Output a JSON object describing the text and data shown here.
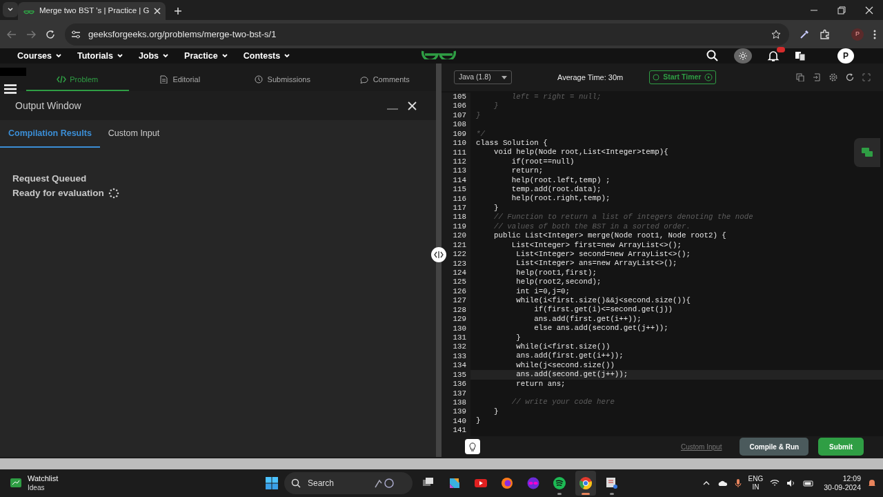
{
  "browser": {
    "tab_title": "Merge two BST 's | Practice | G",
    "url": "geeksforgeeks.org/problems/merge-two-bst-s/1",
    "profile": "P"
  },
  "site_nav": {
    "menus": [
      {
        "label": "Courses"
      },
      {
        "label": "Tutorials"
      },
      {
        "label": "Jobs"
      },
      {
        "label": "Practice"
      },
      {
        "label": "Contests"
      }
    ],
    "avatar": "P"
  },
  "problem_tabs": [
    {
      "label": "Problem",
      "selected": true
    },
    {
      "label": "Editorial",
      "selected": false
    },
    {
      "label": "Submissions",
      "selected": false
    },
    {
      "label": "Comments",
      "selected": false
    }
  ],
  "output_window": {
    "title": "Output Window",
    "tabs": [
      {
        "label": "Compilation Results",
        "selected": true
      },
      {
        "label": "Custom Input",
        "selected": false
      }
    ],
    "messages": [
      {
        "text": "Request Queued",
        "loading": false
      },
      {
        "text": "Ready for evaluation",
        "loading": true
      }
    ]
  },
  "editor": {
    "language": "Java (1.8)",
    "average_time": "Average Time: 30m",
    "timer_button": "Start Timer",
    "lines": [
      {
        "num": "105",
        "kind": "comment",
        "current": false,
        "text": "        left = right = null;"
      },
      {
        "num": "106",
        "kind": "comment",
        "current": false,
        "text": "    }"
      },
      {
        "num": "107",
        "kind": "comment",
        "current": false,
        "text": "}"
      },
      {
        "num": "108",
        "current": false
      },
      {
        "num": "109",
        "kind": "comment",
        "current": false,
        "text": "*/"
      },
      {
        "num": "110",
        "kind": "code",
        "current": false,
        "text": "class Solution {"
      },
      {
        "num": "111",
        "kind": "code",
        "current": false,
        "text": "    void help(Node root,List<Integer>temp){"
      },
      {
        "num": "112",
        "kind": "code",
        "current": false,
        "text": "        if(root==null)"
      },
      {
        "num": "113",
        "kind": "code",
        "current": false,
        "text": "        return;"
      },
      {
        "num": "114",
        "kind": "code",
        "current": false,
        "text": "        help(root.left,temp) ;"
      },
      {
        "num": "115",
        "kind": "code",
        "current": false,
        "text": "        temp.add(root.data);"
      },
      {
        "num": "116",
        "kind": "code",
        "current": false,
        "text": "        help(root.right,temp);"
      },
      {
        "num": "117",
        "kind": "code",
        "current": false,
        "text": "    }"
      },
      {
        "num": "118",
        "kind": "comment",
        "current": false,
        "text": "    // Function to return a list of integers denoting the node"
      },
      {
        "num": "119",
        "kind": "comment",
        "current": false,
        "text": "    // values of both the BST in a sorted order."
      },
      {
        "num": "120",
        "kind": "code",
        "current": false,
        "text": "    public List<Integer> merge(Node root1, Node root2) {"
      },
      {
        "num": "121",
        "kind": "code",
        "current": false,
        "text": "        List<Integer> first=new ArrayList<>();"
      },
      {
        "num": "122",
        "kind": "code",
        "current": false,
        "text": "         List<Integer> second=new ArrayList<>();"
      },
      {
        "num": "123",
        "kind": "code",
        "current": false,
        "text": "         List<Integer> ans=new ArrayList<>();"
      },
      {
        "num": "124",
        "kind": "code",
        "current": false,
        "text": "         help(root1,first);"
      },
      {
        "num": "125",
        "kind": "code",
        "current": false,
        "text": "         help(root2,second);"
      },
      {
        "num": "126",
        "kind": "code",
        "current": false,
        "text": "         int i=0,j=0;"
      },
      {
        "num": "127",
        "kind": "code",
        "current": false,
        "text": "         while(i<first.size()&&j<second.size()){"
      },
      {
        "num": "128",
        "kind": "code",
        "current": false,
        "text": "             if(first.get(i)<=second.get(j))"
      },
      {
        "num": "129",
        "kind": "code",
        "current": false,
        "text": "             ans.add(first.get(i++));"
      },
      {
        "num": "130",
        "kind": "code",
        "current": false,
        "text": "             else ans.add(second.get(j++));"
      },
      {
        "num": "131",
        "kind": "code",
        "current": false,
        "text": "         }"
      },
      {
        "num": "132",
        "kind": "code",
        "current": false,
        "text": "         while(i<first.size())"
      },
      {
        "num": "133",
        "kind": "code",
        "current": false,
        "text": "         ans.add(first.get(i++));"
      },
      {
        "num": "134",
        "kind": "code",
        "current": false,
        "text": "         while(j<second.size())"
      },
      {
        "num": "135",
        "kind": "code",
        "current": true,
        "text": "         ans.add(second.get(j++));"
      },
      {
        "num": "136",
        "kind": "code",
        "current": false,
        "text": "         return ans;"
      },
      {
        "num": "137",
        "current": false
      },
      {
        "num": "138",
        "kind": "comment",
        "current": false,
        "text": "        // write your code here"
      },
      {
        "num": "139",
        "kind": "code",
        "current": false,
        "text": "    }"
      },
      {
        "num": "140",
        "kind": "code",
        "current": false,
        "text": "}"
      },
      {
        "num": "141",
        "current": false
      }
    ]
  },
  "footer": {
    "custom_input": "Custom Input",
    "compile_button": "Compile & Run",
    "submit_button": "Submit"
  },
  "taskbar": {
    "widget_title": "Watchlist",
    "widget_subtitle": "Ideas",
    "search_placeholder": "Search",
    "apps": [
      {
        "kind": "task-view",
        "active": false,
        "running": false
      },
      {
        "kind": "assistant",
        "active": false,
        "running": false
      },
      {
        "kind": "video",
        "active": false,
        "running": false
      },
      {
        "kind": "fox-browser",
        "active": false,
        "running": false
      },
      {
        "kind": "mask",
        "active": false,
        "running": false
      },
      {
        "kind": "music",
        "active": false,
        "running": true
      },
      {
        "kind": "browser",
        "active": true,
        "running": true
      },
      {
        "kind": "snip",
        "active": false,
        "running": true
      }
    ],
    "language": "ENG",
    "region": "IN",
    "time": "12:09",
    "date": "30-09-2024"
  }
}
